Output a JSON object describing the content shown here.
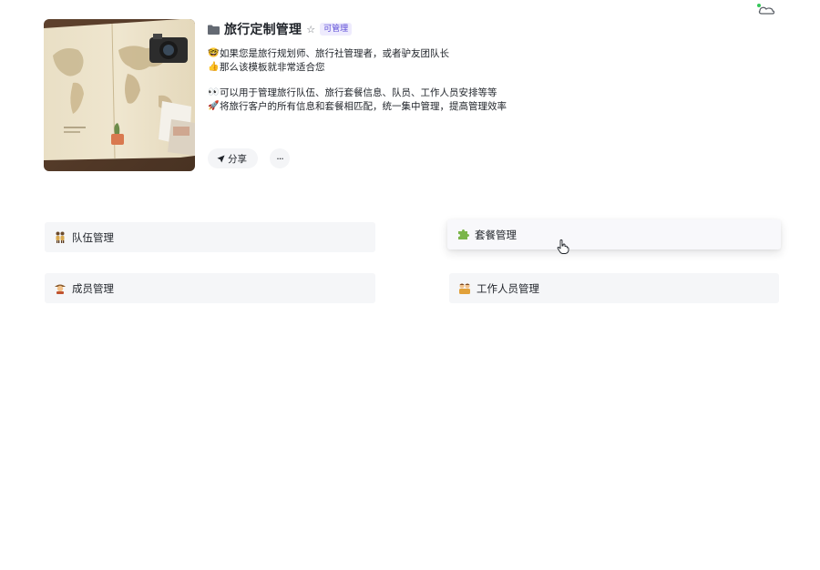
{
  "page": {
    "title": "旅行定制管理",
    "badge": "可管理",
    "description": [
      {
        "emoji": "🤓",
        "text": "如果您是旅行规划师、旅行社管理者，或者驴友团队长"
      },
      {
        "emoji": "👍",
        "text": "那么该模板就非常适合您"
      },
      {
        "emoji": "",
        "text": ""
      },
      {
        "emoji": "👀",
        "text": "可以用于管理旅行队伍、旅行套餐信息、队员、工作人员安排等等"
      },
      {
        "emoji": "🚀",
        "text": "将旅行客户的所有信息和套餐相匹配，统一集中管理，提高管理效率"
      }
    ]
  },
  "actions": {
    "share_label": "分享",
    "more_label": "···"
  },
  "cards": [
    {
      "label": "队伍管理",
      "icon": "team-icon"
    },
    {
      "label": "套餐管理",
      "icon": "puzzle-icon"
    },
    {
      "label": "成员管理",
      "icon": "member-icon"
    },
    {
      "label": "工作人员管理",
      "icon": "staff-icon"
    }
  ],
  "colors": {
    "accent": "#5b4bd6",
    "card_bg": "#f5f6f8",
    "text": "#1f2329"
  }
}
